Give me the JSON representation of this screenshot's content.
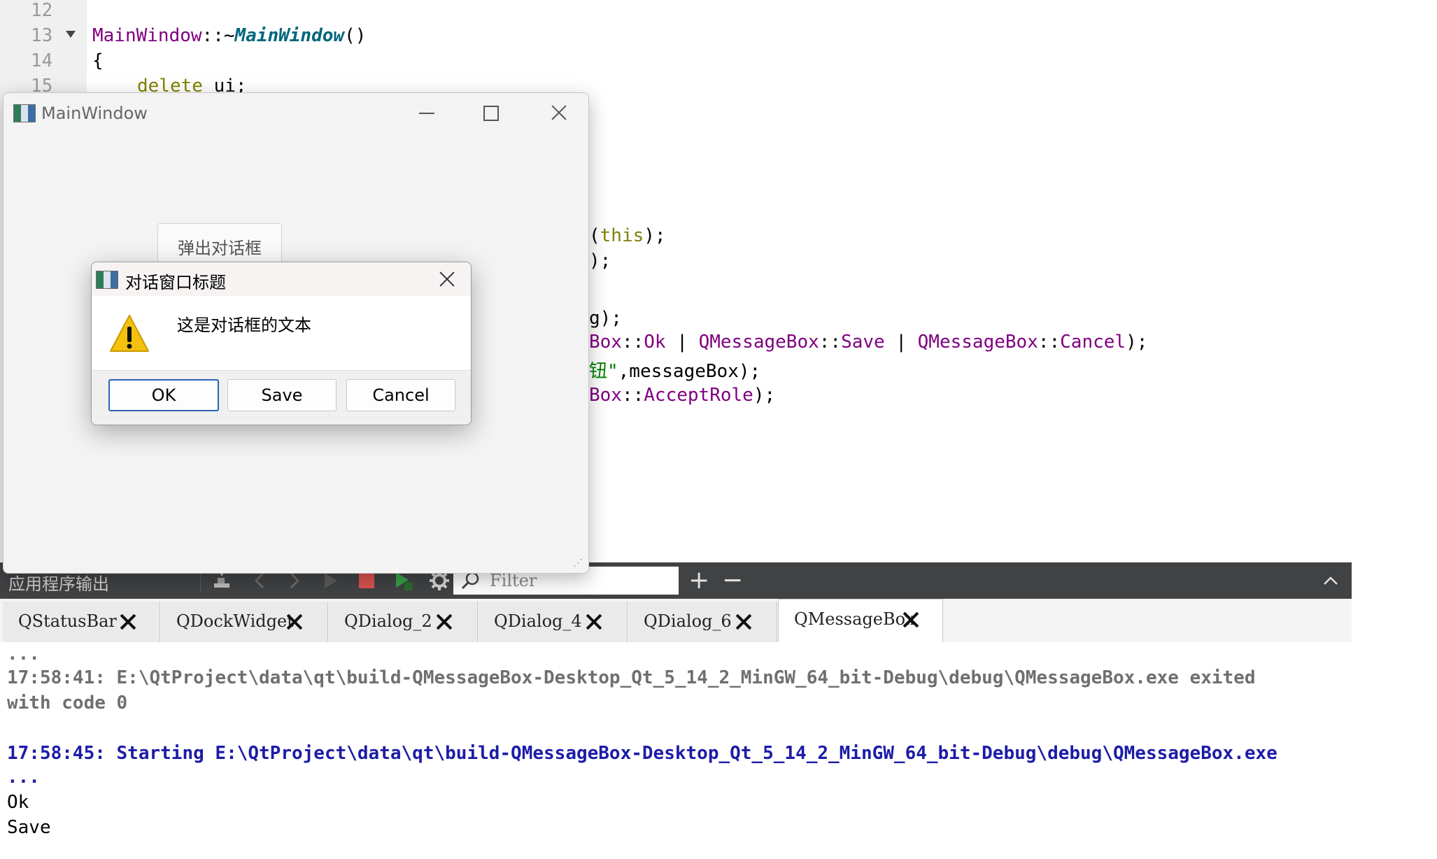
{
  "editor": {
    "line_numbers": [
      "12",
      "13",
      "14",
      "15"
    ],
    "line13": {
      "cls": "MainWindow",
      "sep": "::~",
      "fn": "MainWindow",
      "paren": "()"
    },
    "line14": "{",
    "line15": {
      "kw": "delete",
      "rest": " ui;"
    },
    "frag1": {
      "paren": "(",
      "kw": "this",
      "tail": ");"
    },
    "frag2": ");",
    "frag3": "g);",
    "frag4": {
      "a": "Box",
      "b": "::",
      "c": "Ok",
      "d": " | ",
      "e": "QMessageBox",
      "f": "::",
      "g": "Save",
      "h": " | ",
      "i": "QMessageBox",
      "j": "::",
      "k": "Cancel",
      "l": ");"
    },
    "frag5": {
      "str": "钮\"",
      "rest": ",messageBox);"
    },
    "frag6": {
      "a": "Box",
      "b": "::",
      "c": "AcceptRole",
      "d": ");"
    }
  },
  "main_window": {
    "title": "MainWindow",
    "popup_button": "弹出对话框"
  },
  "message_box": {
    "title": "对话窗口标题",
    "text": "这是对话框的文本",
    "buttons": {
      "ok": "OK",
      "save": "Save",
      "cancel": "Cancel"
    }
  },
  "output_toolbar": {
    "title": "应用程序输出",
    "filter_placeholder": "Filter",
    "add": "+",
    "remove": "−"
  },
  "tabs": [
    "QStatusBar",
    "QDockWidget",
    "QDialog_2",
    "QDialog_4",
    "QDialog_6",
    "QMessageBox"
  ],
  "active_tab": "QMessageBox",
  "output": {
    "line1": "...",
    "line2": "17:58:41: E:\\QtProject\\data\\qt\\build-QMessageBox-Desktop_Qt_5_14_2_MinGW_64_bit-Debug\\debug\\QMessageBox.exe exited",
    "line3": "with code 0",
    "line4": "17:58:45: Starting E:\\QtProject\\data\\qt\\build-QMessageBox-Desktop_Qt_5_14_2_MinGW_64_bit-Debug\\debug\\QMessageBox.exe",
    "line5": "...",
    "line6": "Ok",
    "line7": "Save"
  },
  "colors": {
    "keyword": "#808000",
    "class": "#800080",
    "function": "#00677c",
    "string": "#008000",
    "output_blue": "#1c1ca8",
    "output_gray": "#6f6f6f",
    "toolbar_bg": "#404244",
    "stop_red": "#d9534f",
    "run_green": "#3aa14a",
    "warning_yellow": "#f4c20d"
  },
  "icons": [
    "build-icon",
    "prev-icon",
    "next-icon",
    "run-icon",
    "stop-icon",
    "run-debug-icon",
    "settings-icon",
    "search-icon",
    "warning-icon",
    "collapse-icon"
  ]
}
